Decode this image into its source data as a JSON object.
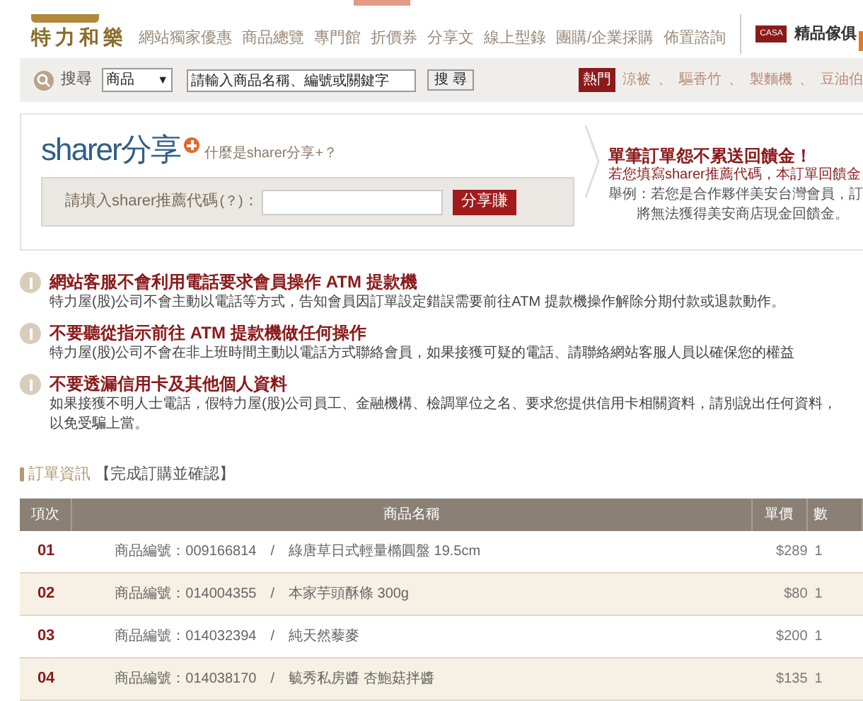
{
  "logo": "特力和樂",
  "nav": [
    {
      "label": "網站獨家優惠"
    },
    {
      "label": "商品總覽"
    },
    {
      "label": "專門館"
    },
    {
      "label": "折價券"
    },
    {
      "label": "分享文"
    },
    {
      "label": "線上型錄"
    },
    {
      "label": "團購/企業採購"
    },
    {
      "label": "佈置諮詢"
    }
  ],
  "brand": {
    "badge": "CASA",
    "label": "精品傢俱"
  },
  "search": {
    "label": "搜尋",
    "category": "商品",
    "arrow": "▼",
    "value": "請輸入商品名稱、編號或關鍵字",
    "button": "搜 尋",
    "hot_label": "熱門",
    "hot": [
      "涼被",
      "驅香竹",
      "製麵機",
      "豆油伯"
    ],
    "separator": "、"
  },
  "sharer": {
    "logo": "sharer分享",
    "help_link": "什麼是sharer分享+？",
    "field_label": "請填入sharer推薦代碼",
    "hint": "(？)",
    "colon": "：",
    "button": "分享賺",
    "promo_title": "單筆訂單怨不累送回饋金！",
    "promo_lines": [
      "若您填寫sharer推薦代碼，本訂單回饋金",
      "舉例：若您是合作夥伴美安台灣會員，訂",
      "將無法獲得美安商店現金回饋金。"
    ]
  },
  "warnings": [
    {
      "title": "網站客服不會利用電話要求會員操作 ATM 提款機",
      "text": "特力屋(股)公司不會主動以電話等方式，告知會員因訂單設定錯誤需要前往ATM 提款機操作解除分期付款或退款動作。"
    },
    {
      "title": "不要聽從指示前往 ATM 提款機做任何操作",
      "text": "特力屋(股)公司不會在非上班時間主動以電話方式聯絡會員，如果接獲可疑的電話、請聯絡網站客服人員以確保您的權益"
    },
    {
      "title": "不要透漏信用卡及其他個人資料",
      "text": "如果接獲不明人士電話，假特力屋(股)公司員工、金融機構、檢調單位之名、要求您提供信用卡相關資料，請別說出任何資料，以免受騙上當。"
    }
  ],
  "order": {
    "title": "訂單資訊",
    "subtitle": "【完成訂購並確認】",
    "columns": [
      "項次",
      "商品名稱",
      "單價",
      "數"
    ],
    "rows": [
      {
        "index": "01",
        "name": "商品編號：009166814　/　綠唐草日式輕量橢圓盤 19.5cm",
        "price": "$289",
        "qty": "1"
      },
      {
        "index": "02",
        "name": "商品編號：014004355　/　本家芋頭酥條 300g",
        "price": "$80",
        "qty": "1"
      },
      {
        "index": "03",
        "name": "商品編號：014032394　/　純天然藜麥",
        "price": "$200",
        "qty": "1"
      },
      {
        "index": "04",
        "name": "商品編號：014038170　/　毓秀私房醬 杏鮑菇拌醬",
        "price": "$135",
        "qty": "1"
      }
    ]
  }
}
